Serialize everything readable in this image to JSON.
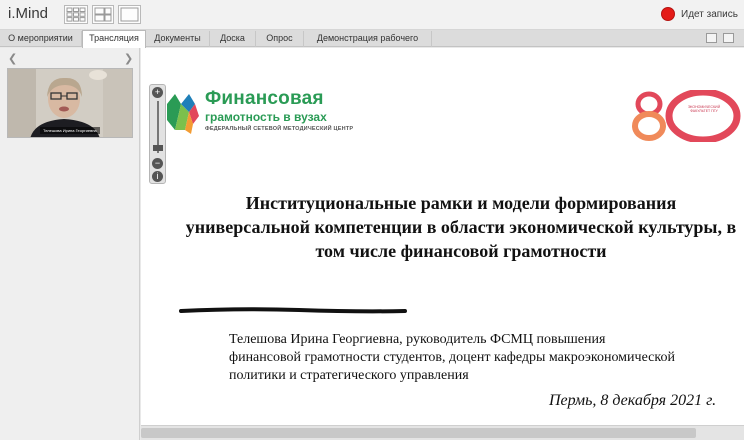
{
  "app": {
    "title": "i.Mind"
  },
  "recording": {
    "label": "Идет запись",
    "color": "#e41b17"
  },
  "tabs": [
    {
      "label": "О мероприятии"
    },
    {
      "label": "Трансляция"
    },
    {
      "label": "Документы"
    },
    {
      "label": "Доска"
    },
    {
      "label": "Опрос"
    },
    {
      "label": "Демонстрация рабочего стола"
    }
  ],
  "active_tab": "Трансляция",
  "video": {
    "caption": "Телешова Ирина Георгиевна"
  },
  "slide": {
    "logo_left": {
      "line1": "Финансовая",
      "line2": "грамотность в вузах",
      "line3": "ФЕДЕРАЛЬНЫЙ СЕТЕВОЙ МЕТОДИЧЕСКИЙ ЦЕНТР",
      "color": "#2a9b55"
    },
    "logo_right": {
      "number": "80",
      "label": "ЭКОНОМИЧЕСКИЙ ФАКУЛЬТЕТ ПГУ",
      "color": "#e2485a"
    },
    "title": "Институциональные рамки и модели формирования универсальной компетенции в области экономической культуры, в том числе финансовой грамотности",
    "author_lines": [
      "Телешова Ирина Георгиевна, руководитель ФСМЦ повышения",
      "финансовой грамотности студентов, доцент кафедры макроэкономической",
      "политики и стратегического управления"
    ],
    "date": "Пермь, 8 декабря 2021 г."
  },
  "icons": {
    "grid_layout": "grid-layout-icon",
    "split_layout": "split-layout-icon",
    "single_layout": "single-layout-icon",
    "zoom_in": "zoom-in-icon",
    "zoom_out": "zoom-out-icon",
    "info": "info-icon"
  }
}
